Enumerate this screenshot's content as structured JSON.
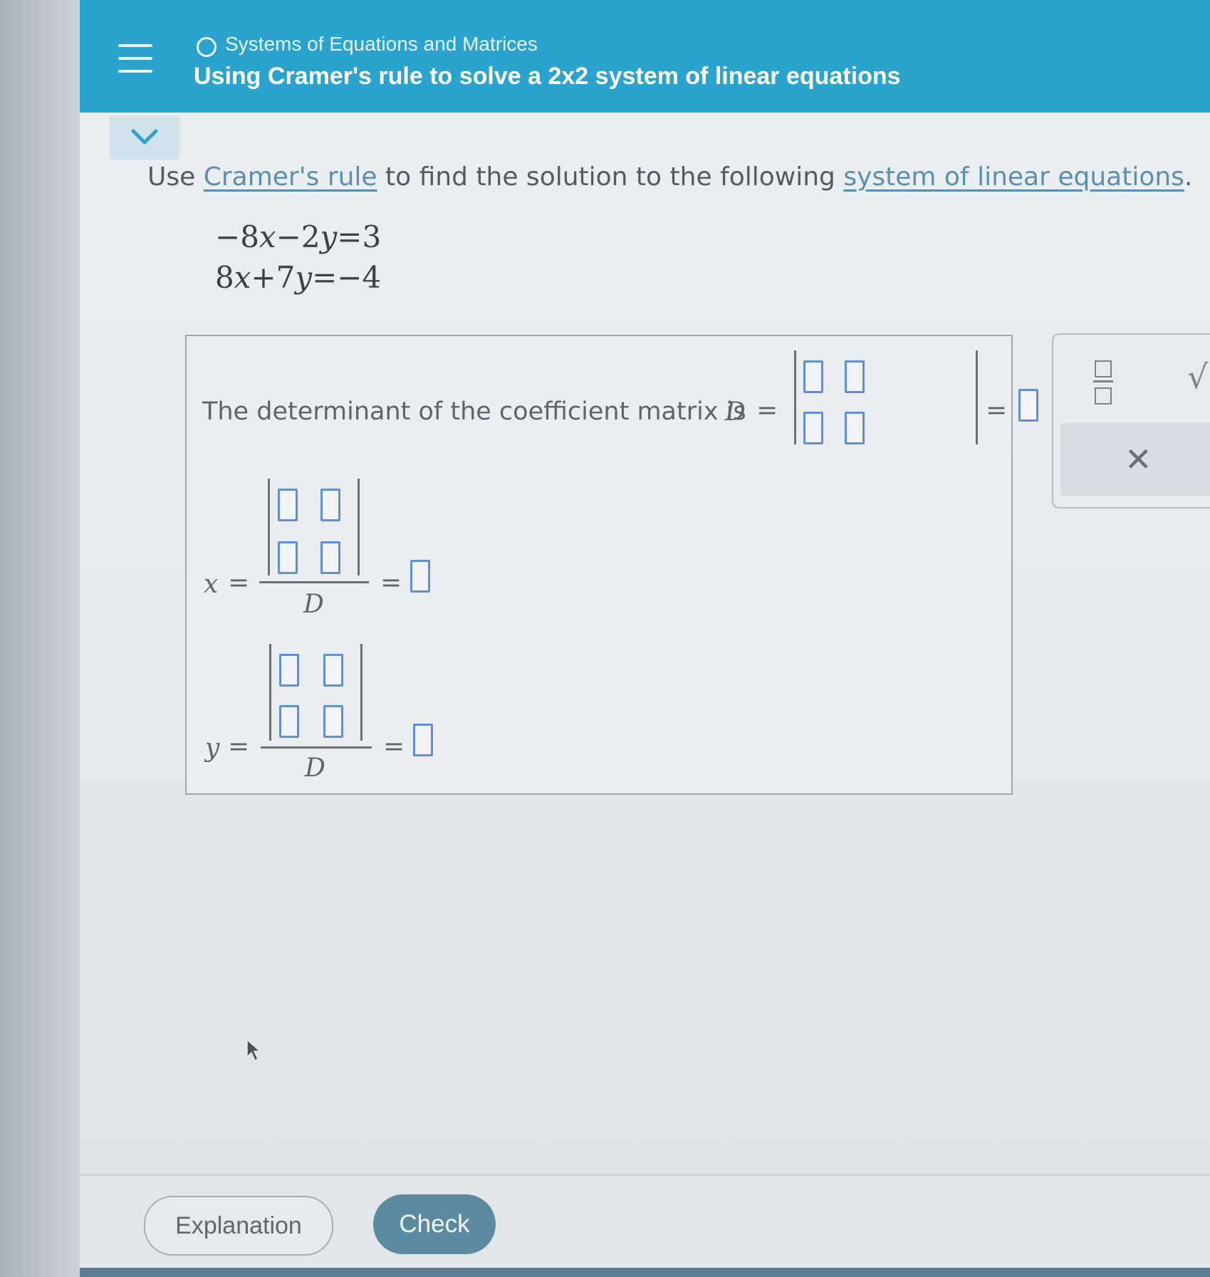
{
  "header": {
    "topic": "Systems of Equations and Matrices",
    "title": "Using Cramer's rule to solve a 2x2 system of linear equations"
  },
  "question": {
    "prefix": "Use ",
    "link1": "Cramer's rule",
    "middle": " to find the solution to the following ",
    "link2": "system of linear equations",
    "suffix": "."
  },
  "equations": [
    {
      "a": "−8",
      "x": "x",
      "op": "−",
      "b": "2",
      "y": "y",
      "eq": "=",
      "rhs": "3"
    },
    {
      "a": "8",
      "x": "x",
      "op": "+",
      "b": "7",
      "y": "y",
      "eq": "=",
      "rhs": "−4"
    }
  ],
  "answer": {
    "det_text": "The determinant of the coefficient matrix is",
    "D_symbol": "D",
    "x_symbol": "x",
    "y_symbol": "y",
    "equals": "="
  },
  "tools": {
    "sqrt_glyph": "√",
    "clear_glyph": "✕"
  },
  "footer": {
    "explanation_label": "Explanation",
    "check_label": "Check"
  },
  "colors": {
    "header": "#2ba3cf",
    "link": "#5c8fab",
    "slot_border": "#5f8fd6",
    "check_button": "#5c8aa1"
  }
}
